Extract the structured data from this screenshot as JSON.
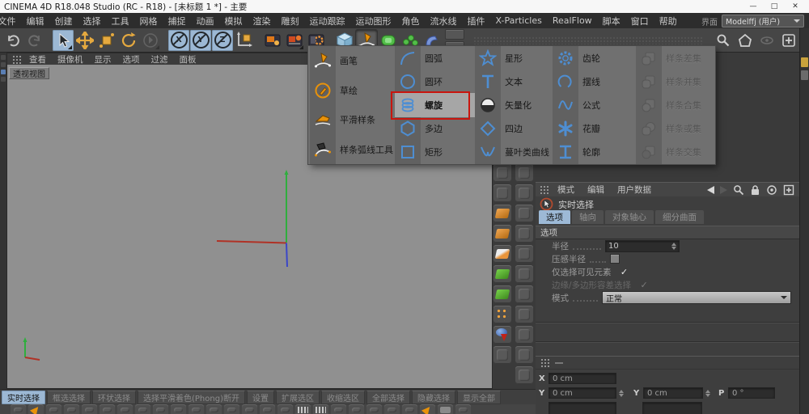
{
  "window": {
    "title": "CINEMA 4D R18.048 Studio (RC - R18) - [未标题 1 *] - 主要",
    "controls": [
      "—",
      "□",
      "✕"
    ]
  },
  "menubar": {
    "items": [
      "文件",
      "编辑",
      "创建",
      "选择",
      "工具",
      "网格",
      "捕捉",
      "动画",
      "模拟",
      "渲染",
      "雕刻",
      "运动跟踪",
      "运动图形",
      "角色",
      "流水线",
      "插件",
      "X-Particles",
      "RealFlow",
      "脚本",
      "窗口",
      "帮助"
    ],
    "interface_label": "界面",
    "interface_value": "Modelffj (用户)"
  },
  "toolbar": {
    "axis_labels": [
      "X",
      "Y",
      "Z"
    ]
  },
  "spline_menu": {
    "columns": [
      {
        "items": [
          {
            "label": "画笔",
            "icon": "pen-icon"
          },
          {
            "label": "草绘",
            "icon": "sketch-icon"
          },
          {
            "label": "平滑样条",
            "icon": "smooth-spline-icon"
          },
          {
            "label": "样条弧线工具",
            "icon": "spline-arc-icon"
          }
        ]
      },
      {
        "items": [
          {
            "label": "圆弧",
            "icon": "arc-icon"
          },
          {
            "label": "圆环",
            "icon": "circle-icon"
          },
          {
            "label": "螺旋",
            "icon": "helix-icon",
            "highlighted": true
          },
          {
            "label": "多边",
            "icon": "ngon-icon"
          },
          {
            "label": "矩形",
            "icon": "rectangle-icon"
          }
        ]
      },
      {
        "items": [
          {
            "label": "星形",
            "icon": "star-icon"
          },
          {
            "label": "文本",
            "icon": "text-icon"
          },
          {
            "label": "矢量化",
            "icon": "vectorize-icon"
          },
          {
            "label": "四边",
            "icon": "quad-icon"
          },
          {
            "label": "蔓叶类曲线",
            "icon": "cissoid-icon"
          }
        ]
      },
      {
        "items": [
          {
            "label": "齿轮",
            "icon": "gear-icon"
          },
          {
            "label": "摆线",
            "icon": "cycloid-icon"
          },
          {
            "label": "公式",
            "icon": "formula-icon"
          },
          {
            "label": "花瓣",
            "icon": "flower-icon"
          },
          {
            "label": "轮廓",
            "icon": "profile-icon"
          }
        ]
      },
      {
        "items": [
          {
            "label": "样条差集",
            "icon": "spline-subtract-icon",
            "disabled": true
          },
          {
            "label": "样条并集",
            "icon": "spline-union-icon",
            "disabled": true
          },
          {
            "label": "样条合集",
            "icon": "spline-and-icon",
            "disabled": true
          },
          {
            "label": "样条或集",
            "icon": "spline-or-icon",
            "disabled": true
          },
          {
            "label": "样条交集",
            "icon": "spline-intersect-icon",
            "disabled": true
          }
        ]
      }
    ]
  },
  "viewport": {
    "menu": [
      "查看",
      "摄像机",
      "显示",
      "选项",
      "过滤",
      "面板"
    ],
    "label": "透视视图"
  },
  "attributes": {
    "menu": [
      "模式",
      "编辑",
      "用户数据"
    ],
    "title": "实时选择",
    "tabs": [
      "选项",
      "轴向",
      "对象轴心",
      "细分曲面"
    ],
    "section": "选项",
    "radius_label": "半径",
    "radius_value": "10",
    "pressure_label": "压感半径",
    "visible_only_label": "仅选择可见元素",
    "visible_only_check": "✓",
    "tolerant_label": "边缘/多边形容差选择",
    "tolerant_check": "✓",
    "mode_label": "模式",
    "mode_value": "正常"
  },
  "coordinates": {
    "x_label": "X",
    "x_value": "0 cm",
    "y_label": "Y",
    "y_value": "0 cm",
    "sy_label": "Y",
    "sy_value": "0 cm",
    "p_label": "P",
    "p_value": "0 °"
  },
  "selection_bar": {
    "buttons": [
      {
        "label": "实时选择",
        "active": true
      },
      {
        "label": "框选选择"
      },
      {
        "label": "环状选择"
      },
      {
        "label": "选择平滑着色(Phong)断开"
      },
      {
        "label": "设置"
      },
      {
        "label": "扩展选区"
      },
      {
        "label": "收缩选区"
      },
      {
        "label": "全部选择"
      },
      {
        "label": "隐藏选择"
      },
      {
        "label": "显示全部"
      }
    ]
  },
  "side_strips": {
    "left": [
      "gray",
      "gray",
      "orange",
      "orange",
      "orange-white",
      "green",
      "green",
      "orange-dots",
      "blue-red",
      "gray"
    ],
    "right": [
      "emboss",
      "emboss",
      "emboss",
      "emboss",
      "emboss",
      "emboss",
      "emboss",
      "emboss",
      "emboss",
      "emboss",
      "emboss"
    ]
  },
  "bottom_icons": [
    "gray",
    "pen",
    "gray",
    "gray",
    "gray",
    "gray",
    "gray",
    "gray",
    "gray",
    "gray",
    "gray",
    "gray",
    "gray",
    "gray",
    "gray",
    "gray",
    "multi",
    "multi",
    "gray",
    "gray",
    "gray",
    "gray",
    "gray",
    "pen",
    "light",
    "gray"
  ]
}
